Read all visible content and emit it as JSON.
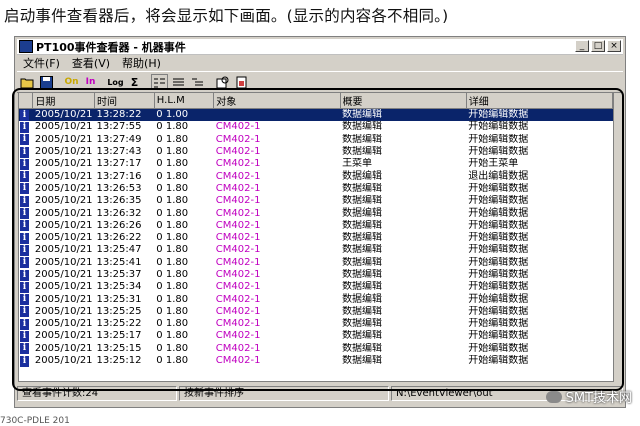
{
  "caption": "启动事件查看器后，将会显示如下画面。(显示的内容各不相同。)",
  "window": {
    "title": "PT100事件查看器 - 机器事件",
    "buttons": {
      "minimize": "_",
      "maximize": "□",
      "close": "×"
    }
  },
  "menu": {
    "items": [
      "文件(F)",
      "查看(V)",
      "帮助(H)"
    ]
  },
  "toolbar": {
    "buttons": [
      "open-icon",
      "save-icon",
      "filter-on-icon",
      "filter-in-icon",
      "log-icon",
      "sum-icon",
      "list-view-icon",
      "detail-view-icon",
      "tree-view-icon",
      "refresh-icon",
      "report-icon"
    ],
    "log_label": "Log",
    "sum_label": "Σ",
    "on_label": "On",
    "in_label": "In"
  },
  "table": {
    "columns": [
      "日期",
      "时间",
      "H.L.M",
      "对象",
      "概要",
      "详细"
    ],
    "rows": [
      {
        "date": "2005/10/21",
        "time": "13:28:22",
        "hlm": "0   1.00",
        "obj": "",
        "summary": "数据编辑",
        "detail": "开始编辑数据",
        "selected": true
      },
      {
        "date": "2005/10/21",
        "time": "13:27:55",
        "hlm": "0   1.80",
        "obj": "CM402-1",
        "summary": "数据编辑",
        "detail": "开始编辑数据"
      },
      {
        "date": "2005/10/21",
        "time": "13:27:49",
        "hlm": "0   1.80",
        "obj": "CM402-1",
        "summary": "数据编辑",
        "detail": "开始编辑数据"
      },
      {
        "date": "2005/10/21",
        "time": "13:27:43",
        "hlm": "0   1.80",
        "obj": "CM402-1",
        "summary": "数据编辑",
        "detail": "开始编辑数据"
      },
      {
        "date": "2005/10/21",
        "time": "13:27:17",
        "hlm": "0   1.80",
        "obj": "CM402-1",
        "summary": "王菜单",
        "detail": "开始王菜单"
      },
      {
        "date": "2005/10/21",
        "time": "13:27:16",
        "hlm": "0   1.80",
        "obj": "CM402-1",
        "summary": "数据编辑",
        "detail": "退出编辑数据"
      },
      {
        "date": "2005/10/21",
        "time": "13:26:53",
        "hlm": "0   1.80",
        "obj": "CM402-1",
        "summary": "数据编辑",
        "detail": "开始编辑数据"
      },
      {
        "date": "2005/10/21",
        "time": "13:26:35",
        "hlm": "0   1.80",
        "obj": "CM402-1",
        "summary": "数据编辑",
        "detail": "开始编辑数据"
      },
      {
        "date": "2005/10/21",
        "time": "13:26:32",
        "hlm": "0   1.80",
        "obj": "CM402-1",
        "summary": "数据编辑",
        "detail": "开始编辑数据"
      },
      {
        "date": "2005/10/21",
        "time": "13:26:26",
        "hlm": "0   1.80",
        "obj": "CM402-1",
        "summary": "数据编辑",
        "detail": "开始编辑数据"
      },
      {
        "date": "2005/10/21",
        "time": "13:26:22",
        "hlm": "0   1.80",
        "obj": "CM402-1",
        "summary": "数据编辑",
        "detail": "开始编辑数据"
      },
      {
        "date": "2005/10/21",
        "time": "13:25:47",
        "hlm": "0   1.80",
        "obj": "CM402-1",
        "summary": "数据编辑",
        "detail": "开始编辑数据"
      },
      {
        "date": "2005/10/21",
        "time": "13:25:41",
        "hlm": "0   1.80",
        "obj": "CM402-1",
        "summary": "数据编辑",
        "detail": "开始编辑数据"
      },
      {
        "date": "2005/10/21",
        "time": "13:25:37",
        "hlm": "0   1.80",
        "obj": "CM402-1",
        "summary": "数据编辑",
        "detail": "开始编辑数据"
      },
      {
        "date": "2005/10/21",
        "time": "13:25:34",
        "hlm": "0   1.80",
        "obj": "CM402-1",
        "summary": "数据编辑",
        "detail": "开始编辑数据"
      },
      {
        "date": "2005/10/21",
        "time": "13:25:31",
        "hlm": "0   1.80",
        "obj": "CM402-1",
        "summary": "数据编辑",
        "detail": "开始编辑数据"
      },
      {
        "date": "2005/10/21",
        "time": "13:25:25",
        "hlm": "0   1.80",
        "obj": "CM402-1",
        "summary": "数据编辑",
        "detail": "开始编辑数据"
      },
      {
        "date": "2005/10/21",
        "time": "13:25:22",
        "hlm": "0   1.80",
        "obj": "CM402-1",
        "summary": "数据编辑",
        "detail": "开始编辑数据"
      },
      {
        "date": "2005/10/21",
        "time": "13:25:17",
        "hlm": "0   1.80",
        "obj": "CM402-1",
        "summary": "数据编辑",
        "detail": "开始编辑数据"
      },
      {
        "date": "2005/10/21",
        "time": "13:25:15",
        "hlm": "0   1.80",
        "obj": "CM402-1",
        "summary": "数据编辑",
        "detail": "开始编辑数据"
      },
      {
        "date": "2005/10/21",
        "time": "13:25:12",
        "hlm": "0   1.80",
        "obj": "CM402-1",
        "summary": "数据编辑",
        "detail": "开始编辑数据"
      }
    ]
  },
  "status": {
    "count": "查看事件计数:24",
    "sort": "按新事件排序",
    "path": "N:\\EventViewer\\out"
  },
  "bottom_label": "730C-PDLE 201",
  "watermark": "SMT技术网",
  "colors": {
    "selection": "#0a246a",
    "object_text": "#c000c0",
    "info_icon": "#1a2f9e"
  }
}
